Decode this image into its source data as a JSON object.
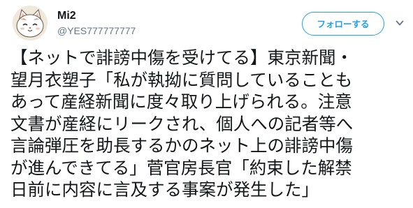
{
  "user": {
    "display_name": "Mi2",
    "handle": "@YES777777777"
  },
  "follow_button": {
    "label": "フォローする"
  },
  "menu": {
    "icon": "chevron-down-icon"
  },
  "avatar": {
    "icon": "cat-avatar-icon"
  },
  "tweet": {
    "lines": [
      "【ネットで誹謗中傷を受けてる】東京新聞・",
      "望月衣塑子「私が執拗に質問していることも",
      "あって産経新聞に度々取り上げられる。注意",
      "文書が産経にリークされ、個人への記者等へ",
      "言論弾圧を助長するかのネット上の誹謗中傷",
      "が進んできてる」菅官房長官「約束した解禁",
      "日前に内容に言及する事案が発生した」"
    ]
  },
  "colors": {
    "accent": "#1da1f2",
    "text": "#14171a",
    "secondary": "#657786"
  }
}
